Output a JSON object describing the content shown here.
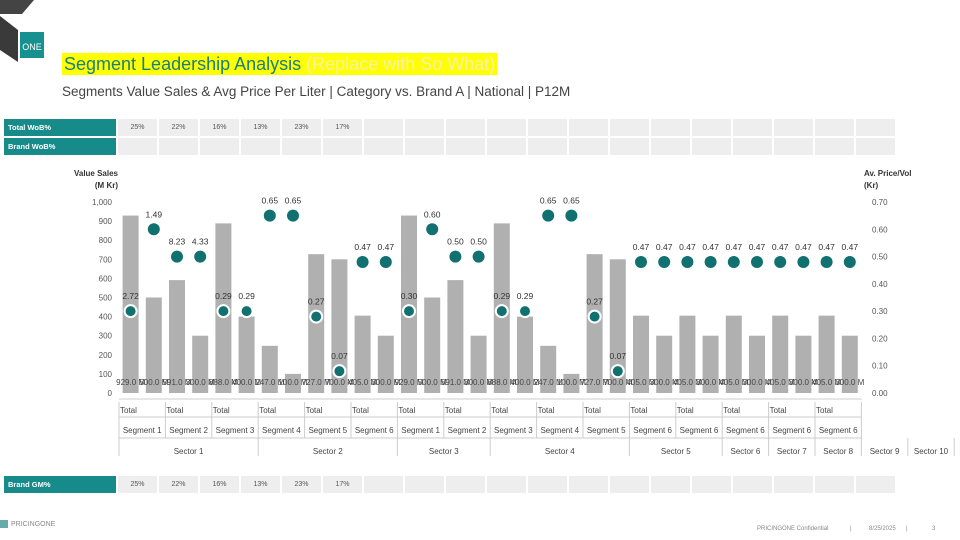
{
  "page": {
    "title_main": "Segment Leadership Analysis",
    "title_sowhat": "(Replace with So What)",
    "subtitle": "Segments Value Sales & Avg Price Per Liter | Category vs. Brand A | National | P12M",
    "logo_text": "ONE",
    "footer_brand": "PRICINGONE",
    "footer_confidential": "PRICINGONE Confidential",
    "footer_sep1": "|",
    "footer_date": "8/25/2025",
    "footer_sep2": "|",
    "footer_page": "3"
  },
  "rows": {
    "total_wob": {
      "label": "Total WoB%",
      "values": [
        "25%",
        "22%",
        "16%",
        "13%",
        "23%",
        "17%",
        "",
        "",
        "",
        "",
        "",
        "",
        "",
        "",
        "",
        "",
        "",
        "",
        ""
      ]
    },
    "brand_wob": {
      "label": "Brand WoB%",
      "values": [
        "",
        "",
        "",
        "",
        "",
        "",
        "",
        "",
        "",
        "",
        "",
        "",
        "",
        "",
        "",
        "",
        "",
        "",
        ""
      ]
    },
    "brand_gm": {
      "label": "Brand GM%",
      "values": [
        "25%",
        "22%",
        "16%",
        "13%",
        "23%",
        "17%",
        "",
        "",
        "",
        "",
        "",
        "",
        "",
        "",
        "",
        "",
        "",
        "",
        ""
      ]
    }
  },
  "colors": {
    "teal": "#1a7f7f",
    "bar": "#b0b0b0",
    "dot": "#117070",
    "highlight": "#ffff00"
  },
  "chart_data": {
    "type": "bar",
    "ylabel_left": "Value Sales (M Kr)",
    "ylabel_right": "Av. Price/Vol (Kr)",
    "ylim_left": [
      0,
      1000
    ],
    "ylim_right": [
      0,
      0.7
    ],
    "yticks_left": [
      "0",
      "100",
      "200",
      "300",
      "400",
      "500",
      "600",
      "700",
      "800",
      "900",
      "1,000"
    ],
    "yticks_right": [
      "0.00",
      "0.10",
      "0.20",
      "0.30",
      "0.40",
      "0.50",
      "0.60",
      "0.70"
    ],
    "grid": false,
    "legend": "none",
    "total_label": "Total",
    "bars": [
      {
        "segment": "Segment 1",
        "v": 929,
        "label": "929.0 M"
      },
      {
        "segment": "",
        "v": 500,
        "label": "500.0 M"
      },
      {
        "segment": "Segment 2",
        "v": 591,
        "label": "591.0 M"
      },
      {
        "segment": "",
        "v": 300,
        "label": "300.0 M"
      },
      {
        "segment": "Segment 3",
        "v": 888,
        "label": "888.0 M"
      },
      {
        "segment": "",
        "v": 400,
        "label": "400.0 M"
      },
      {
        "segment": "Segment 4",
        "v": 247,
        "label": "247.0 M"
      },
      {
        "segment": "",
        "v": 100,
        "label": "100.0 M"
      },
      {
        "segment": "Segment 5",
        "v": 727,
        "label": "727.0 M"
      },
      {
        "segment": "",
        "v": 700,
        "label": "700.0 M"
      },
      {
        "segment": "Segment 6",
        "v": 405,
        "label": "405.0 M"
      },
      {
        "segment": "",
        "v": 300,
        "label": "300.0 M"
      },
      {
        "segment": "Segment 1",
        "v": 929,
        "label": "929.0 M"
      },
      {
        "segment": "",
        "v": 500,
        "label": "500.0 M"
      },
      {
        "segment": "Segment 2",
        "v": 591,
        "label": "591.0 M"
      },
      {
        "segment": "",
        "v": 300,
        "label": "300.0 M"
      },
      {
        "segment": "Segment 3",
        "v": 888,
        "label": "888.0 M"
      },
      {
        "segment": "",
        "v": 400,
        "label": "400.0 M"
      },
      {
        "segment": "Segment 4",
        "v": 247,
        "label": "247.0 M"
      },
      {
        "segment": "",
        "v": 100,
        "label": "100.0 M"
      },
      {
        "segment": "Segment 5",
        "v": 727,
        "label": "727.0 M"
      },
      {
        "segment": "",
        "v": 700,
        "label": "700.0 M"
      },
      {
        "segment": "Segment 6",
        "v": 405,
        "label": "405.0 M"
      },
      {
        "segment": "",
        "v": 300,
        "label": "300.0 M"
      },
      {
        "segment": "Segment 6",
        "v": 405,
        "label": "405.0 M"
      },
      {
        "segment": "",
        "v": 300,
        "label": "300.0 M"
      },
      {
        "segment": "Segment 6",
        "v": 405,
        "label": "405.0 M"
      },
      {
        "segment": "",
        "v": 300,
        "label": "300.0 M"
      },
      {
        "segment": "Segment 6",
        "v": 405,
        "label": "405.0 M"
      },
      {
        "segment": "",
        "v": 300,
        "label": "300.0 M"
      },
      {
        "segment": "Segment 6",
        "v": 405,
        "label": "405.0 M"
      },
      {
        "segment": "",
        "v": 300,
        "label": "300.0 M"
      }
    ],
    "price_points": [
      {
        "v": 0.3,
        "label": "2.72",
        "outlined": true
      },
      {
        "v": 0.6,
        "label": "1.49",
        "outlined": false
      },
      {
        "v": 0.5,
        "label": "8.23",
        "outlined": false
      },
      {
        "v": 0.5,
        "label": "4.33",
        "outlined": false
      },
      {
        "v": 0.3,
        "label": "0.29",
        "outlined": true
      },
      {
        "v": 0.3,
        "label": "0.29",
        "outlined": true
      },
      {
        "v": 0.65,
        "label": "0.65",
        "outlined": false
      },
      {
        "v": 0.65,
        "label": "0.65",
        "outlined": false
      },
      {
        "v": 0.28,
        "label": "0.27",
        "outlined": true
      },
      {
        "v": 0.08,
        "label": "0.07",
        "outlined": true
      },
      {
        "v": 0.48,
        "label": "0.47",
        "outlined": false
      },
      {
        "v": 0.48,
        "label": "0.47",
        "outlined": false
      },
      {
        "v": 0.3,
        "label": "0.30",
        "outlined": true
      },
      {
        "v": 0.6,
        "label": "0.60",
        "outlined": false
      },
      {
        "v": 0.5,
        "label": "0.50",
        "outlined": false
      },
      {
        "v": 0.5,
        "label": "0.50",
        "outlined": false
      },
      {
        "v": 0.3,
        "label": "0.29",
        "outlined": true
      },
      {
        "v": 0.3,
        "label": "0.29",
        "outlined": true
      },
      {
        "v": 0.65,
        "label": "0.65",
        "outlined": false
      },
      {
        "v": 0.65,
        "label": "0.65",
        "outlined": false
      },
      {
        "v": 0.28,
        "label": "0.27",
        "outlined": true
      },
      {
        "v": 0.08,
        "label": "0.07",
        "outlined": true
      },
      {
        "v": 0.48,
        "label": "0.47",
        "outlined": false
      },
      {
        "v": 0.48,
        "label": "0.47",
        "outlined": false
      },
      {
        "v": 0.48,
        "label": "0.47",
        "outlined": false
      },
      {
        "v": 0.48,
        "label": "0.47",
        "outlined": false
      },
      {
        "v": 0.48,
        "label": "0.47",
        "outlined": false
      },
      {
        "v": 0.48,
        "label": "0.47",
        "outlined": false
      },
      {
        "v": 0.48,
        "label": "0.47",
        "outlined": false
      },
      {
        "v": 0.48,
        "label": "0.47",
        "outlined": false
      },
      {
        "v": 0.48,
        "label": "0.47",
        "outlined": false
      },
      {
        "v": 0.48,
        "label": "0.47",
        "outlined": false
      }
    ],
    "sectors": [
      {
        "name": "Sector 1",
        "n": 6
      },
      {
        "name": "Sector 2",
        "n": 6
      },
      {
        "name": "Sector 3",
        "n": 4
      },
      {
        "name": "Sector 4",
        "n": 6
      },
      {
        "name": "Sector 5",
        "n": 4
      },
      {
        "name": "Sector 6",
        "n": 2
      },
      {
        "name": "Sector 7",
        "n": 2
      },
      {
        "name": "Sector 8",
        "n": 2
      },
      {
        "name": "Sector 9",
        "n": 2
      },
      {
        "name": "Sector 10",
        "n": 2
      }
    ]
  }
}
